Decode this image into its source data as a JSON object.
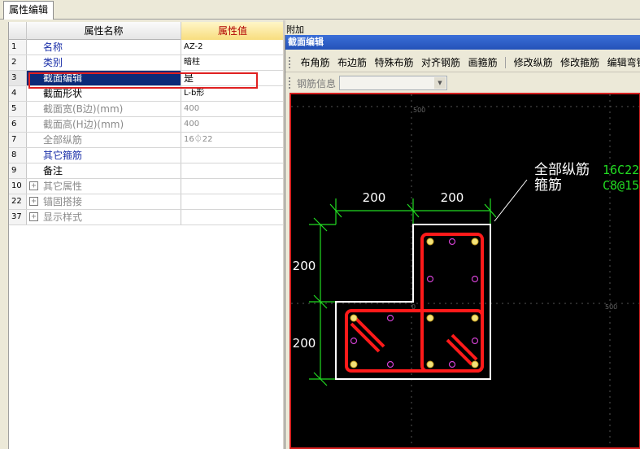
{
  "tab": {
    "label": "属性编辑"
  },
  "grid": {
    "header": {
      "num": "",
      "name": "属性名称",
      "value": "属性值"
    },
    "rows": [
      {
        "num": "1",
        "name": "名称",
        "value": "AZ-2"
      },
      {
        "num": "2",
        "name": "类别",
        "value": "暗柱"
      },
      {
        "num": "3",
        "name": "截面编辑",
        "value": "是"
      },
      {
        "num": "4",
        "name": "截面形状",
        "value": "L-b形"
      },
      {
        "num": "5",
        "name": "截面宽(B边)(mm)",
        "value": "400"
      },
      {
        "num": "6",
        "name": "截面高(H边)(mm)",
        "value": "400"
      },
      {
        "num": "7",
        "name": "全部纵筋",
        "value": "16⏀22"
      },
      {
        "num": "8",
        "name": "其它箍筋",
        "value": ""
      },
      {
        "num": "9",
        "name": "备注",
        "value": ""
      },
      {
        "num": "10",
        "name": "其它属性",
        "value": "",
        "expand": "+"
      },
      {
        "num": "22",
        "name": "锚固搭接",
        "value": "",
        "expand": "+"
      },
      {
        "num": "37",
        "name": "显示样式",
        "value": "",
        "expand": "+"
      }
    ]
  },
  "addon_label": "附加",
  "dialog": {
    "title": "截面编辑",
    "toolbar": [
      "布角筋",
      "布边筋",
      "特殊布筋",
      "对齐钢筋",
      "画箍筋",
      "修改纵筋",
      "修改箍筋",
      "编辑弯钩"
    ],
    "rebar_info_label": "钢筋信息",
    "rebar_select_value": ""
  },
  "drawing": {
    "dim_top_1": "200",
    "dim_top_2": "200",
    "dim_left_1": "200",
    "dim_left_2": "200",
    "grid_label_top": "500",
    "grid_label_right": "500",
    "grid_label_mid": "0",
    "label_longitudinal": "全部纵筋",
    "label_stirrup": "箍筋",
    "value_longitudinal": "16C22",
    "value_stirrup": "C8@15",
    "colors": {
      "background": "#000000",
      "dimension": "#22dd22",
      "outline": "#ffffff",
      "stirrup": "#ff1a1a",
      "bar_fill": "#f2e27a",
      "side_bar": "#d040d0",
      "annotation_value": "#22dd22"
    }
  }
}
